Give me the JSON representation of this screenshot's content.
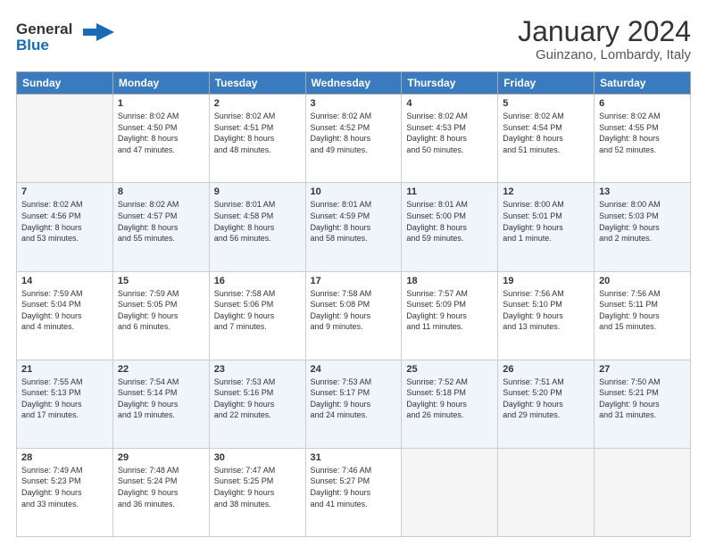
{
  "header": {
    "logo_line1": "General",
    "logo_line2": "Blue",
    "month": "January 2024",
    "location": "Guinzano, Lombardy, Italy"
  },
  "weekdays": [
    "Sunday",
    "Monday",
    "Tuesday",
    "Wednesday",
    "Thursday",
    "Friday",
    "Saturday"
  ],
  "weeks": [
    [
      {
        "num": "",
        "info": ""
      },
      {
        "num": "1",
        "info": "Sunrise: 8:02 AM\nSunset: 4:50 PM\nDaylight: 8 hours\nand 47 minutes."
      },
      {
        "num": "2",
        "info": "Sunrise: 8:02 AM\nSunset: 4:51 PM\nDaylight: 8 hours\nand 48 minutes."
      },
      {
        "num": "3",
        "info": "Sunrise: 8:02 AM\nSunset: 4:52 PM\nDaylight: 8 hours\nand 49 minutes."
      },
      {
        "num": "4",
        "info": "Sunrise: 8:02 AM\nSunset: 4:53 PM\nDaylight: 8 hours\nand 50 minutes."
      },
      {
        "num": "5",
        "info": "Sunrise: 8:02 AM\nSunset: 4:54 PM\nDaylight: 8 hours\nand 51 minutes."
      },
      {
        "num": "6",
        "info": "Sunrise: 8:02 AM\nSunset: 4:55 PM\nDaylight: 8 hours\nand 52 minutes."
      }
    ],
    [
      {
        "num": "7",
        "info": "Sunrise: 8:02 AM\nSunset: 4:56 PM\nDaylight: 8 hours\nand 53 minutes."
      },
      {
        "num": "8",
        "info": "Sunrise: 8:02 AM\nSunset: 4:57 PM\nDaylight: 8 hours\nand 55 minutes."
      },
      {
        "num": "9",
        "info": "Sunrise: 8:01 AM\nSunset: 4:58 PM\nDaylight: 8 hours\nand 56 minutes."
      },
      {
        "num": "10",
        "info": "Sunrise: 8:01 AM\nSunset: 4:59 PM\nDaylight: 8 hours\nand 58 minutes."
      },
      {
        "num": "11",
        "info": "Sunrise: 8:01 AM\nSunset: 5:00 PM\nDaylight: 8 hours\nand 59 minutes."
      },
      {
        "num": "12",
        "info": "Sunrise: 8:00 AM\nSunset: 5:01 PM\nDaylight: 9 hours\nand 1 minute."
      },
      {
        "num": "13",
        "info": "Sunrise: 8:00 AM\nSunset: 5:03 PM\nDaylight: 9 hours\nand 2 minutes."
      }
    ],
    [
      {
        "num": "14",
        "info": "Sunrise: 7:59 AM\nSunset: 5:04 PM\nDaylight: 9 hours\nand 4 minutes."
      },
      {
        "num": "15",
        "info": "Sunrise: 7:59 AM\nSunset: 5:05 PM\nDaylight: 9 hours\nand 6 minutes."
      },
      {
        "num": "16",
        "info": "Sunrise: 7:58 AM\nSunset: 5:06 PM\nDaylight: 9 hours\nand 7 minutes."
      },
      {
        "num": "17",
        "info": "Sunrise: 7:58 AM\nSunset: 5:08 PM\nDaylight: 9 hours\nand 9 minutes."
      },
      {
        "num": "18",
        "info": "Sunrise: 7:57 AM\nSunset: 5:09 PM\nDaylight: 9 hours\nand 11 minutes."
      },
      {
        "num": "19",
        "info": "Sunrise: 7:56 AM\nSunset: 5:10 PM\nDaylight: 9 hours\nand 13 minutes."
      },
      {
        "num": "20",
        "info": "Sunrise: 7:56 AM\nSunset: 5:11 PM\nDaylight: 9 hours\nand 15 minutes."
      }
    ],
    [
      {
        "num": "21",
        "info": "Sunrise: 7:55 AM\nSunset: 5:13 PM\nDaylight: 9 hours\nand 17 minutes."
      },
      {
        "num": "22",
        "info": "Sunrise: 7:54 AM\nSunset: 5:14 PM\nDaylight: 9 hours\nand 19 minutes."
      },
      {
        "num": "23",
        "info": "Sunrise: 7:53 AM\nSunset: 5:16 PM\nDaylight: 9 hours\nand 22 minutes."
      },
      {
        "num": "24",
        "info": "Sunrise: 7:53 AM\nSunset: 5:17 PM\nDaylight: 9 hours\nand 24 minutes."
      },
      {
        "num": "25",
        "info": "Sunrise: 7:52 AM\nSunset: 5:18 PM\nDaylight: 9 hours\nand 26 minutes."
      },
      {
        "num": "26",
        "info": "Sunrise: 7:51 AM\nSunset: 5:20 PM\nDaylight: 9 hours\nand 29 minutes."
      },
      {
        "num": "27",
        "info": "Sunrise: 7:50 AM\nSunset: 5:21 PM\nDaylight: 9 hours\nand 31 minutes."
      }
    ],
    [
      {
        "num": "28",
        "info": "Sunrise: 7:49 AM\nSunset: 5:23 PM\nDaylight: 9 hours\nand 33 minutes."
      },
      {
        "num": "29",
        "info": "Sunrise: 7:48 AM\nSunset: 5:24 PM\nDaylight: 9 hours\nand 36 minutes."
      },
      {
        "num": "30",
        "info": "Sunrise: 7:47 AM\nSunset: 5:25 PM\nDaylight: 9 hours\nand 38 minutes."
      },
      {
        "num": "31",
        "info": "Sunrise: 7:46 AM\nSunset: 5:27 PM\nDaylight: 9 hours\nand 41 minutes."
      },
      {
        "num": "",
        "info": ""
      },
      {
        "num": "",
        "info": ""
      },
      {
        "num": "",
        "info": ""
      }
    ]
  ]
}
